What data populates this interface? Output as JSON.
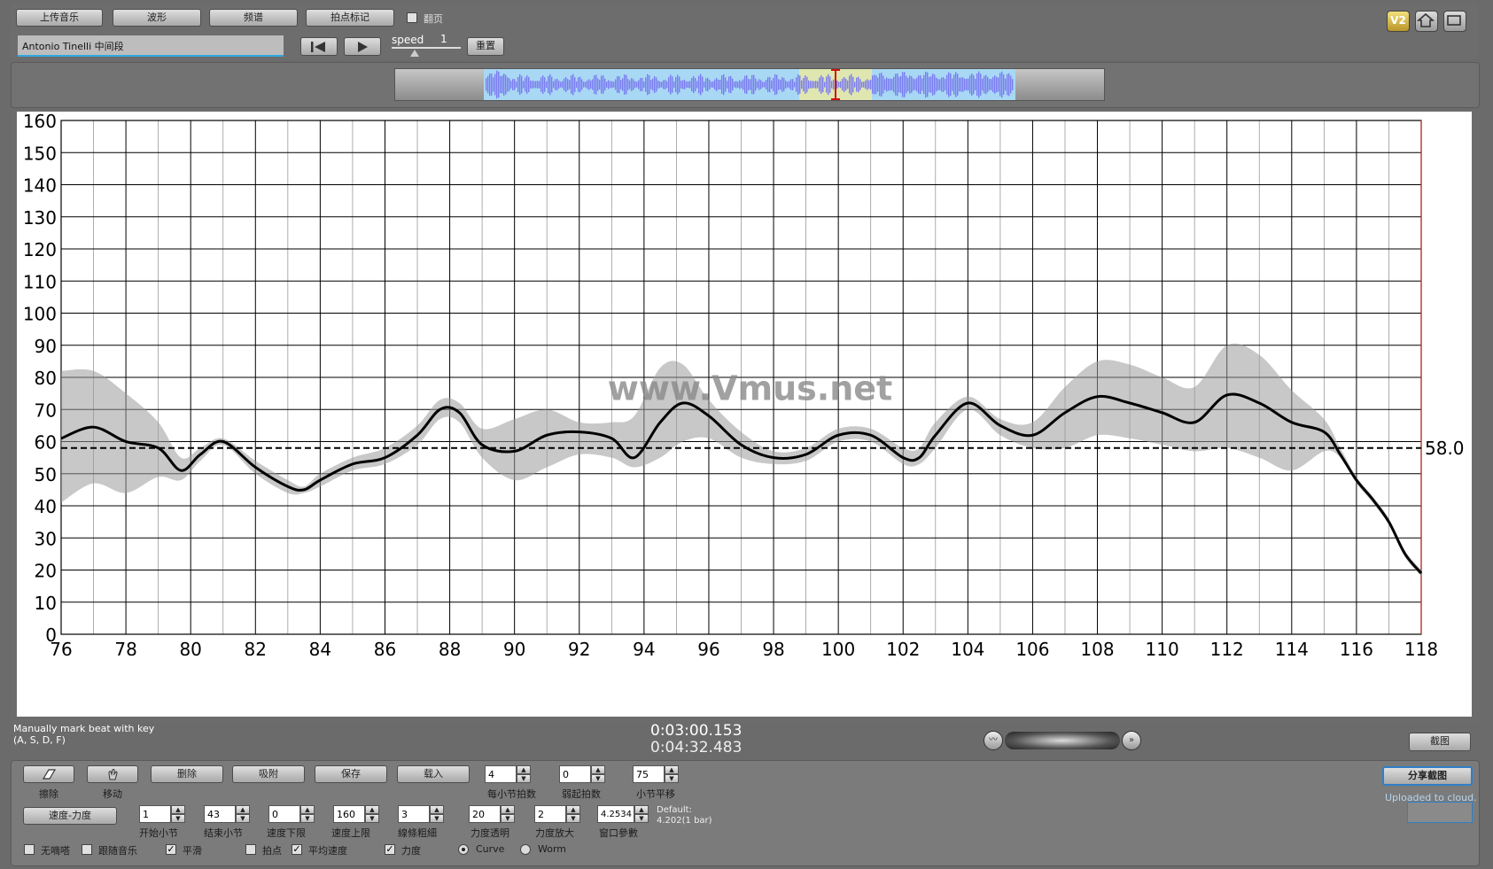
{
  "toolbar": {
    "upload_label": "上传音乐",
    "waveform_label": "波形",
    "spectrum_label": "频谱",
    "beatmark_label": "拍点标记",
    "flip_label": "翻页",
    "track_name": "Antonio Tinelli 中间段",
    "speed_label": "speed",
    "speed_value": "1",
    "reset_label": "重置"
  },
  "corner_icons": {
    "v2_label": "V2",
    "home": "home-icon",
    "screen": "fullscreen-icon"
  },
  "chart_data": {
    "type": "line",
    "title": "",
    "xlabel": "",
    "ylabel": "",
    "xlim": [
      76,
      118
    ],
    "ylim": [
      0,
      160
    ],
    "x_ticks": [
      76,
      78,
      80,
      82,
      84,
      86,
      88,
      90,
      92,
      94,
      96,
      98,
      100,
      102,
      104,
      106,
      108,
      110,
      112,
      114,
      116,
      118
    ],
    "y_ticks": [
      0,
      10,
      20,
      30,
      40,
      50,
      60,
      70,
      80,
      90,
      100,
      110,
      120,
      130,
      140,
      150,
      160
    ],
    "average_line": 58.0,
    "average_label": "58.0",
    "watermark": "www.Vmus.net",
    "series": [
      {
        "x": [
          76,
          77,
          78,
          79,
          79.7,
          80.3,
          81,
          82,
          83,
          83.5,
          84,
          85,
          86,
          87,
          87.7,
          88.3,
          89,
          90,
          91,
          92,
          93,
          93.7,
          94.5,
          95.2,
          96,
          97,
          98,
          99,
          100,
          101,
          102,
          102.5,
          103,
          104,
          105,
          106,
          107,
          108,
          109,
          110,
          111,
          112,
          113,
          114,
          115,
          115.5,
          116,
          116.5,
          117,
          117.5,
          118
        ],
        "values": [
          61,
          64.5,
          60,
          58,
          51,
          56,
          60,
          52,
          46,
          45,
          48,
          53,
          55,
          62,
          70,
          69,
          59,
          57,
          62,
          63,
          61,
          55,
          66,
          72,
          68,
          59,
          55,
          56,
          62,
          62,
          55,
          55,
          62,
          72,
          65,
          62,
          69,
          74,
          72,
          69,
          66,
          74.5,
          72,
          66,
          63,
          56,
          48,
          42,
          35,
          25,
          19
        ]
      }
    ],
    "band_upper": [
      82,
      82,
      75,
      66,
      55,
      58,
      61,
      54,
      48,
      46,
      50,
      55,
      58,
      65,
      73,
      72,
      64,
      67,
      70,
      66,
      66,
      68,
      83,
      84,
      73,
      63,
      57,
      58,
      64,
      64,
      58,
      58,
      66,
      74,
      67,
      66,
      77,
      85,
      84,
      80,
      77,
      90,
      87,
      76,
      67,
      58,
      49,
      43,
      36,
      26,
      20
    ],
    "band_lower": [
      41,
      47,
      44,
      49,
      48,
      54,
      59,
      50,
      44,
      44,
      46,
      51,
      53,
      59,
      67,
      66,
      55,
      48,
      52,
      56,
      55,
      52,
      55,
      60,
      61,
      55,
      53,
      54,
      60,
      60,
      53,
      53,
      58,
      70,
      62,
      58,
      58,
      62,
      61,
      59,
      57,
      58,
      55,
      51,
      57,
      55,
      47,
      41,
      34,
      24,
      18
    ]
  },
  "status": {
    "hint_line1": "Manually mark beat with key",
    "hint_line2": "(A, S, D, F)",
    "time_current": "0:03:00.153",
    "time_total": "0:04:32.483",
    "screenshot_label": "截图"
  },
  "bottom": {
    "erase_label": "擦除",
    "move_label": "移动",
    "delete_label": "删除",
    "snap_label": "吸附",
    "save_label": "保存",
    "load_label": "载入",
    "beats_per_bar_label": "每小节拍数",
    "beats_per_bar_value": "4",
    "pickup_label": "弱起拍数",
    "pickup_value": "0",
    "bar_shift_label": "小节平移",
    "bar_shift_value": "75",
    "share_label": "分享截图",
    "uploaded_label": "Uploaded to cloud.",
    "mode_label": "速度-力度",
    "start_bar_label": "开始小节",
    "start_bar_value": "1",
    "end_bar_label": "结束小节",
    "end_bar_value": "43",
    "tempo_min_label": "速度下限",
    "tempo_min_value": "0",
    "tempo_max_label": "速度上限",
    "tempo_max_value": "160",
    "line_width_label": "線條粗細",
    "line_width_value": "3",
    "dyn_alpha_label": "力度透明",
    "dyn_alpha_value": "20",
    "dyn_scale_label": "力度放大",
    "dyn_scale_value": "2",
    "window_label": "窗口參數",
    "window_value": "4.2534",
    "default_line1": "Default:",
    "default_line2": "4.202(1 bar)",
    "opt_tick_label": "无嘀嗒",
    "opt_follow_label": "跟随音乐",
    "opt_smooth_label": "平滑",
    "opt_beats_label": "拍点",
    "opt_avg_label": "平均速度",
    "opt_dyn_label": "力度",
    "radio_curve_label": "Curve",
    "radio_worm_label": "Worm"
  }
}
